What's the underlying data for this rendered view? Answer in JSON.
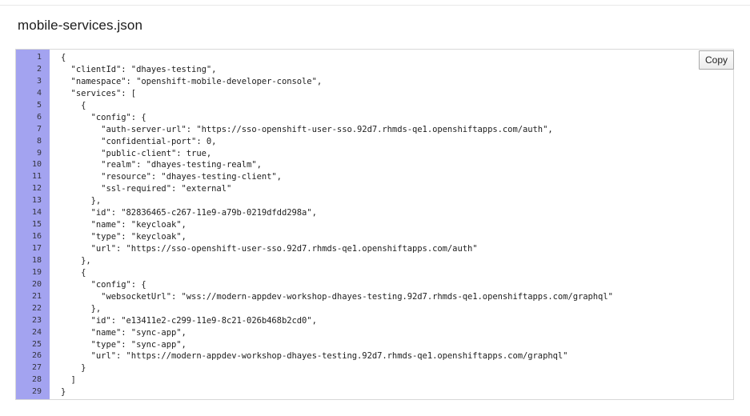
{
  "page": {
    "title": "mobile-services.json"
  },
  "toolbar": {
    "copy_label": "Copy"
  },
  "code_block": {
    "language": "json",
    "gutter_color": "#a3a3f0",
    "line_numbers": [
      "1",
      "2",
      "3",
      "4",
      "5",
      "6",
      "7",
      "8",
      "9",
      "10",
      "11",
      "12",
      "13",
      "14",
      "15",
      "16",
      "17",
      "18",
      "19",
      "20",
      "21",
      "22",
      "23",
      "24",
      "25",
      "26",
      "27",
      "28",
      "29"
    ],
    "lines": [
      "{",
      "  \"clientId\": \"dhayes-testing\",",
      "  \"namespace\": \"openshift-mobile-developer-console\",",
      "  \"services\": [",
      "    {",
      "      \"config\": {",
      "        \"auth-server-url\": \"https://sso-openshift-user-sso.92d7.rhmds-qe1.openshiftapps.com/auth\",",
      "        \"confidential-port\": 0,",
      "        \"public-client\": true,",
      "        \"realm\": \"dhayes-testing-realm\",",
      "        \"resource\": \"dhayes-testing-client\",",
      "        \"ssl-required\": \"external\"",
      "      },",
      "      \"id\": \"82836465-c267-11e9-a79b-0219dfdd298a\",",
      "      \"name\": \"keycloak\",",
      "      \"type\": \"keycloak\",",
      "      \"url\": \"https://sso-openshift-user-sso.92d7.rhmds-qe1.openshiftapps.com/auth\"",
      "    },",
      "    {",
      "      \"config\": {",
      "        \"websocketUrl\": \"wss://modern-appdev-workshop-dhayes-testing.92d7.rhmds-qe1.openshiftapps.com/graphql\"",
      "      },",
      "      \"id\": \"e13411e2-c299-11e9-8c21-026b468b2cd0\",",
      "      \"name\": \"sync-app\",",
      "      \"type\": \"sync-app\",",
      "      \"url\": \"https://modern-appdev-workshop-dhayes-testing.92d7.rhmds-qe1.openshiftapps.com/graphql\"",
      "    }",
      "  ]",
      "}"
    ]
  }
}
